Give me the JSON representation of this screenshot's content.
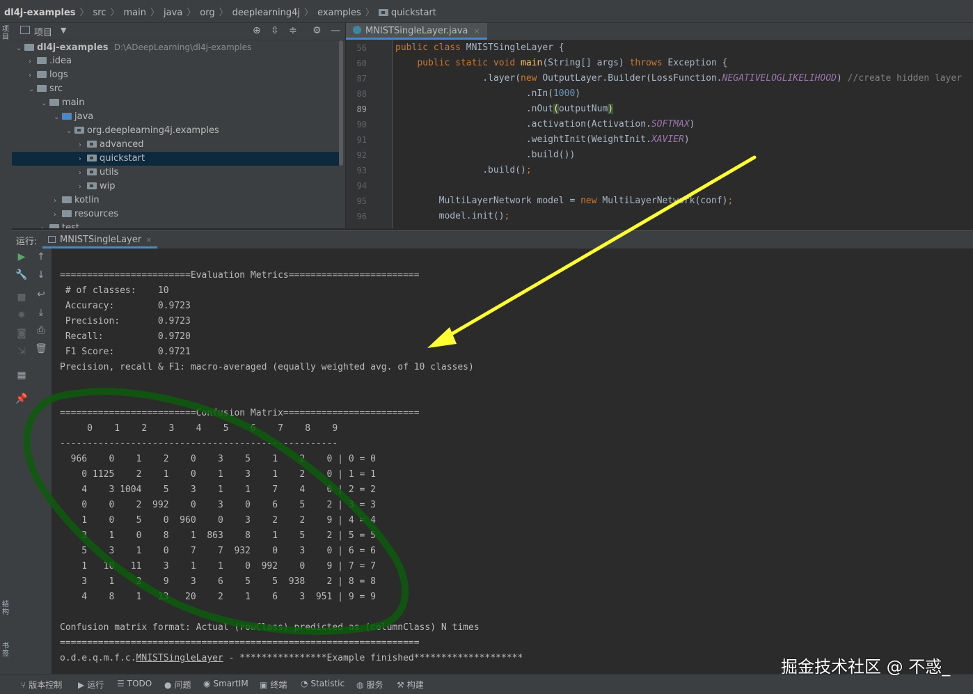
{
  "breadcrumb": [
    "dl4j-examples",
    "src",
    "main",
    "java",
    "org",
    "deeplearning4j",
    "examples",
    "quickstart"
  ],
  "project_panel": {
    "title": "项目",
    "root_name": "dl4j-examples",
    "root_path": "D:\\ADeepLearning\\dl4j-examples",
    "items": [
      {
        "label": ".idea"
      },
      {
        "label": "logs"
      },
      {
        "label": "src"
      },
      {
        "label": "main"
      },
      {
        "label": "java"
      },
      {
        "label": "org.deeplearning4j.examples"
      },
      {
        "label": "advanced"
      },
      {
        "label": "quickstart"
      },
      {
        "label": "utils"
      },
      {
        "label": "wip"
      },
      {
        "label": "kotlin"
      },
      {
        "label": "resources"
      },
      {
        "label": "test"
      }
    ]
  },
  "left_strip": {
    "top_label": "项目",
    "mid_label": "结构",
    "bottom_label": "书签"
  },
  "editor": {
    "tab_label": "MNISTSingleLayer.java",
    "line_numbers": [
      "56",
      "60",
      "87",
      "88",
      "89",
      "90",
      "91",
      "92",
      "93",
      "94",
      "95",
      "96"
    ],
    "current_line": "89"
  },
  "run_panel": {
    "label": "运行:",
    "tab_label": "MNISTSingleLayer",
    "console": {
      "eval_header": "========================Evaluation Metrics========================",
      "metrics": [
        " # of classes:    10",
        " Accuracy:        0.9723",
        " Precision:       0.9723",
        " Recall:          0.9720",
        " F1 Score:        0.9721"
      ],
      "macro_note": "Precision, recall & F1: macro-averaged (equally weighted avg. of 10 classes)",
      "cm_header": "=========================Confusion Matrix=========================",
      "cm_columns": "     0    1    2    3    4    5    6    7    8    9",
      "cm_divider": "---------------------------------------------------",
      "cm_rows": [
        "  966    0    1    2    0    3    5    1    2    0 | 0 = 0",
        "    0 1125    2    1    0    1    3    1    2    0 | 1 = 1",
        "    4    3 1004    5    3    1    1    7    4    0 | 2 = 2",
        "    0    0    2  992    0    3    0    6    5    2 | 3 = 3",
        "    1    0    5    0  960    0    3    2    2    9 | 4 = 4",
        "    3    1    0    8    1  863    8    1    5    2 | 5 = 5",
        "    5    3    1    0    7    7  932    0    3    0 | 6 = 6",
        "    1   10   11    3    1    1    0  992    0    9 | 7 = 7",
        "    3    1    2    9    3    6    5    5  938    2 | 8 = 8",
        "    4    8    1   13   20    2    1    6    3  951 | 9 = 9"
      ],
      "cm_format": "Confusion matrix format: Actual (rowClass) predicted as (columnClass) N times",
      "footer_rule": "==================================================================",
      "finish_prefix": "o.d.e.q.m.f.c.",
      "finish_class": "MNISTSingleLayer",
      "finish_suffix": " - ****************Example finished********************"
    }
  },
  "status_bar": {
    "items": [
      {
        "icon": "vcs-icon",
        "label": "版本控制"
      },
      {
        "icon": "run-icon",
        "label": "运行"
      },
      {
        "icon": "todo-icon",
        "label": "TODO"
      },
      {
        "icon": "problems-icon",
        "label": "问题"
      },
      {
        "icon": "smartim-icon",
        "label": "SmartIM"
      },
      {
        "icon": "terminal-icon",
        "label": "终端"
      },
      {
        "icon": "statistic-icon",
        "label": "Statistic"
      },
      {
        "icon": "services-icon",
        "label": "服务"
      },
      {
        "icon": "build-icon",
        "label": "构建"
      }
    ]
  },
  "watermark": "掘金技术社区 @ 不惑_",
  "colors": {
    "annotation_arrow": "#ffff33",
    "annotation_circle": "#0d5c0d",
    "selection": "#0d293e",
    "accent": "#4a88c7"
  }
}
